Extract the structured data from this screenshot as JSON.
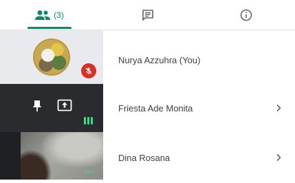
{
  "tabs": [
    {
      "id": "people",
      "icon": "people-icon",
      "count_label": "(3)",
      "selected": true
    },
    {
      "id": "chat",
      "icon": "chat-icon"
    },
    {
      "id": "info",
      "icon": "info-icon"
    }
  ],
  "participants": [
    {
      "name": "Nurya Azzuhra (You)",
      "muted": true,
      "has_chevron": false
    },
    {
      "name": "Friesta Ade Monita",
      "pinned": true,
      "presenting": true,
      "speaking": true,
      "has_chevron": true
    },
    {
      "name": "Dina Rosana",
      "video_on": true,
      "has_chevron": true
    }
  ],
  "colors": {
    "accent": "#0b8a6b",
    "muted_badge": "#d93025",
    "speaking_indicator": "#3ddc84"
  }
}
